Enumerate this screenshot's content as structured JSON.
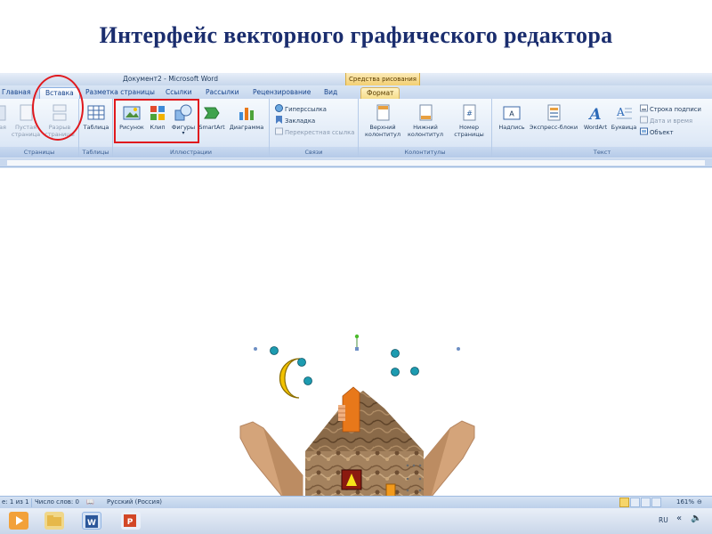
{
  "slide": {
    "title": "Интерфейс векторного графического редактора"
  },
  "window": {
    "title": "Документ2 - Microsoft Word",
    "context_tab_header": "Средства рисования"
  },
  "tabs": [
    "Главная",
    "Вставка",
    "Разметка страницы",
    "Ссылки",
    "Рассылки",
    "Рецензирование",
    "Вид",
    "Формат"
  ],
  "active_tab": "Вставка",
  "ribbon": {
    "pages_group": {
      "label": "Страницы",
      "blank_page": "Пустая страница",
      "page_break": "Разрыв страницы",
      "cover": "ая"
    },
    "tables_group": {
      "label": "Таблицы",
      "table": "Таблица"
    },
    "illustrations_group": {
      "label": "Иллюстрации",
      "picture": "Рисунок",
      "clip": "Клип",
      "shapes": "Фигуры",
      "smartart": "SmartArt",
      "chart": "Диаграмма"
    },
    "links_group": {
      "label": "Связи",
      "hyperlink": "Гиперссылка",
      "bookmark": "Закладка",
      "cross_reference": "Перекрестная ссылка"
    },
    "header_footer_group": {
      "label": "Колонтитулы",
      "header": "Верхний колонтитул",
      "footer": "Нижний колонтитул",
      "page_number": "Номер страницы"
    },
    "text_group": {
      "label": "Текст",
      "textbox": "Надпись",
      "quick_parts": "Экспресс-блоки",
      "wordart": "WordArt",
      "dropcap": "Буквица",
      "signature_line": "Строка подписи",
      "date_time": "Дата и время",
      "object": "Объект"
    }
  },
  "status_bar": {
    "page": "е: 1 из 1",
    "words": "Число слов: 0",
    "language": "Русский (Россия)",
    "zoom": "161%"
  },
  "taskbar": {
    "lang": "RU"
  },
  "colors": {
    "title": "#1a2d6e",
    "highlight": "#e0191e",
    "moon": "#f2c200",
    "star": "#1d9bb0",
    "roof": "#e8781a",
    "door": "#f29a1c",
    "window": "#8b1a10"
  }
}
